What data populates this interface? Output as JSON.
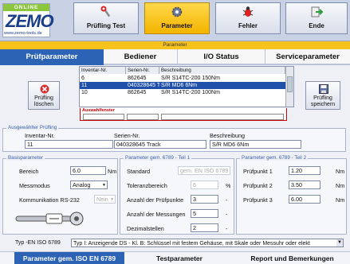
{
  "logo": {
    "badge": "ONLINE",
    "brand": "ZEMO",
    "url": "www.zemo-tools.de"
  },
  "toolbar": [
    {
      "label": "Prüfling Test",
      "icon": "wrench-icon"
    },
    {
      "label": "Parameter",
      "icon": "gear-icon",
      "active": true
    },
    {
      "label": "Fehler",
      "icon": "bug-icon"
    },
    {
      "label": "Ende",
      "icon": "exit-icon"
    }
  ],
  "strip_label": "Parameter",
  "tabs_top": [
    "Prüfparameter",
    "Bediener",
    "I/O Status",
    "Serviceparameter"
  ],
  "buttons": {
    "delete": "Prüfling löschen",
    "save": "Prüfling speichern"
  },
  "grid": {
    "headers": [
      "Inventar-Nr.",
      "Serien-Nr.",
      "Beschreibung"
    ],
    "rows": [
      [
        "6",
        "862645",
        "S/R S14TC-200 150Nm"
      ],
      [
        "11",
        "040328645 Track",
        "S/R MD6 6Nm"
      ],
      [
        "10",
        "862645",
        "S/R S14TC-200 100Nm"
      ]
    ],
    "selected_row": 1
  },
  "auswahl_label": "Auswahlfenster",
  "selected": {
    "legend": "Ausgewählter Prüfling",
    "inv_label": "Inventar-Nr.",
    "inv_value": "11",
    "serial_label": "Serien-Nr.",
    "serial_value": "040328645 Track",
    "desc_label": "Beschreibung",
    "desc_value": "S/R MD6 6Nm"
  },
  "basis": {
    "legend": "Basisparameter",
    "bereich_label": "Bereich",
    "bereich_value": "6.0",
    "bereich_unit": "Nm",
    "mess_label": "Messmodus",
    "mess_value": "Analog",
    "komm_label": "Kommunikation RS-232",
    "komm_value": "Nein"
  },
  "teil1": {
    "legend": "Parameter gem. 6789 - Teil 1",
    "standard_label": "Standard",
    "standard_value": "gem. EN ISO 6789",
    "tol_label": "Toleranzbereich",
    "tol_value": "6",
    "tol_unit": "%",
    "anz_pp_label": "Anzahl der Prüfpunkte",
    "anz_pp_value": "3",
    "anz_pp_unit": "-",
    "anz_mess_label": "Anzahl der Messungen",
    "anz_mess_value": "5",
    "anz_mess_unit": "-",
    "dez_label": "Dezimalstellen",
    "dez_value": "2",
    "dez_unit": "-"
  },
  "teil2": {
    "legend": "Parameter gem. 6789 - Teil 2",
    "p1_label": "Prüfpunkt 1",
    "p1_value": "1.20",
    "p1_unit": "Nm",
    "p2_label": "Prüfpunkt 2",
    "p2_value": "3.50",
    "p2_unit": "Nm",
    "p3_label": "Prüfpunkt 3",
    "p3_value": "6.00",
    "p3_unit": "Nm"
  },
  "typ": {
    "label": "Typ -EN ISO 6789",
    "value": "Typ  I: Anzeigende DS - Kl. B: Schlüssel mit festem Gehäuse, mit Skale oder Messuhr oder elekt"
  },
  "tabs_bottom": [
    "Parameter gem. ISO EN 6789",
    "Testparameter",
    "Report und Bemerkungen"
  ]
}
